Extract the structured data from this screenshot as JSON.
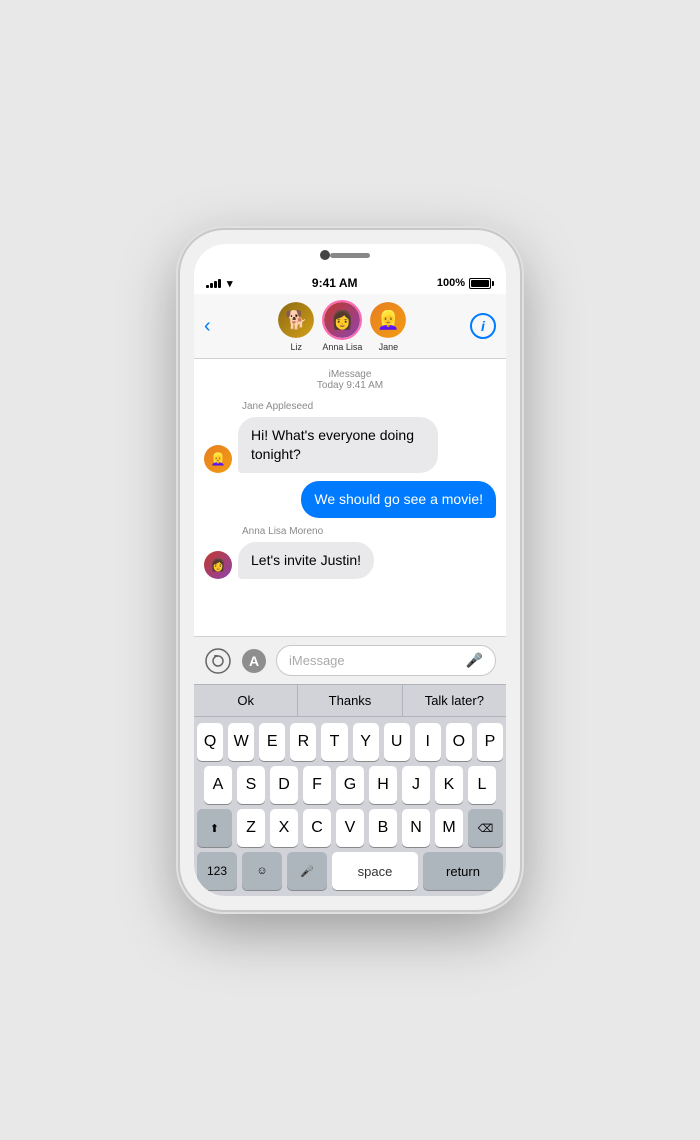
{
  "status": {
    "time": "9:41 AM",
    "battery": "100%",
    "signal_bars": [
      3,
      5,
      7,
      9,
      11
    ],
    "wifi": "wifi"
  },
  "nav": {
    "back_label": "‹",
    "participants": [
      {
        "name": "Liz",
        "avatar_emoji": "🐕",
        "avatar_bg": "liz",
        "highlighted": false
      },
      {
        "name": "Anna Lisa",
        "avatar_emoji": "👩",
        "avatar_bg": "anna",
        "highlighted": true
      },
      {
        "name": "Jane",
        "avatar_emoji": "👱‍♀️",
        "avatar_bg": "jane",
        "highlighted": false
      }
    ],
    "info_label": "i"
  },
  "messages": {
    "timestamp_label": "iMessage",
    "timestamp_detail": "Today 9:41 AM",
    "items": [
      {
        "type": "received",
        "sender": "Jane Appleseed",
        "text": "Hi! What's everyone doing tonight?",
        "avatar_bg": "jane",
        "avatar_emoji": "👱‍♀️"
      },
      {
        "type": "sent",
        "text": "We should go see a movie!"
      },
      {
        "type": "received",
        "sender": "Anna Lisa Moreno",
        "text": "Let's invite Justin!",
        "avatar_bg": "anna",
        "avatar_emoji": "👩"
      }
    ]
  },
  "input": {
    "placeholder": "iMessage",
    "camera_label": "📷",
    "appstore_label": "Ⓐ"
  },
  "predictive": {
    "suggestions": [
      "Ok",
      "Thanks",
      "Talk later?"
    ]
  },
  "keyboard": {
    "row1": [
      "Q",
      "W",
      "E",
      "R",
      "T",
      "Y",
      "U",
      "I",
      "O",
      "P"
    ],
    "row2": [
      "A",
      "S",
      "D",
      "F",
      "G",
      "H",
      "J",
      "K",
      "L"
    ],
    "row3": [
      "Z",
      "X",
      "C",
      "V",
      "B",
      "N",
      "M"
    ],
    "shift_label": "⬆",
    "delete_label": "⌫",
    "numbers_label": "123",
    "emoji_label": "☺",
    "mic_label": "🎤",
    "space_label": "space",
    "return_label": "return"
  }
}
